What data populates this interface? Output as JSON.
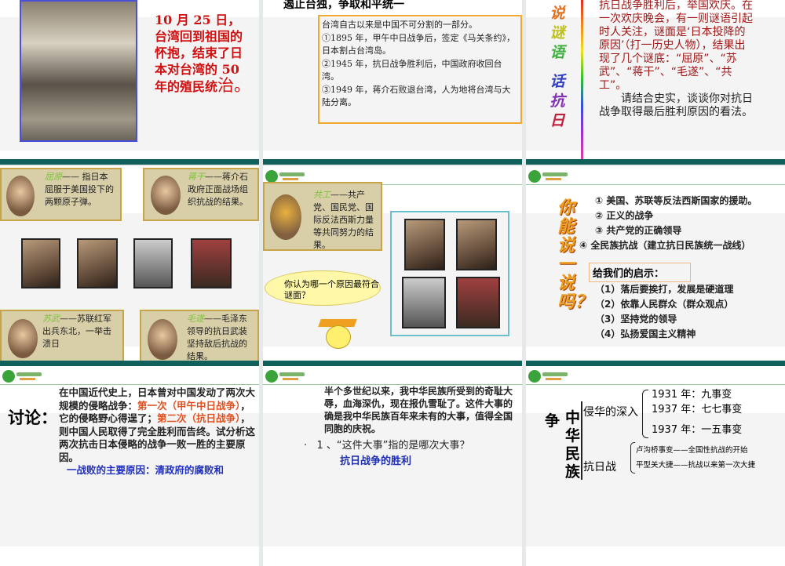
{
  "slides": [
    {
      "text_a": "10 月 25 日，",
      "text_b": "台湾回到祖国的怀抱，结束了日本对台湾的 50 年的殖民统",
      "text_c": "治。"
    },
    {
      "title": "遏止台独，争取和平统一",
      "lines": [
        "台湾自古以来是中国不可分割的一部分。",
        "①1895 年，甲午中日战争后，签定《马关条约》，日本割占台湾岛。",
        "②1945 年，抗日战争胜利后，中国政府收回台湾。",
        "③1949 年，蒋介石败退台湾，人为地将台湾与大陆分离。"
      ]
    },
    {
      "side_chars": [
        "说",
        "谜",
        "语",
        "话",
        "抗",
        "日"
      ],
      "riddle": "抗日战争胜利后，举国欢庆。在一次欢庆晚会，有一则谜语引起时人关注，谜面是‘日本投降的原因’（打一历史人物），结果出现了几个谜底：“屈原”、“苏武”、“蒋干”、“毛遂”、“共工”。",
      "prompt": "请结合史实，谈谈你对抗日战争取得最后胜利原因的看法。"
    },
    {
      "bubbles": [
        {
          "name": "屈原",
          "text": "—— 指日本屈服于美国投下的两颗原子弹。"
        },
        {
          "name": "蒋干",
          "text": "——蒋介石政府正面战场组织抗战的结果。"
        },
        {
          "name": "苏武",
          "text": "——苏联红军出兵东北，一举击溃日"
        },
        {
          "name": "毛遂",
          "text": "——毛泽东领导的抗日武装坚持敌后抗战的结果。"
        }
      ]
    },
    {
      "bubble_name": "共工",
      "bubble_text": "——共产党、国民党、国际反法西斯力量等共同努力的结果。",
      "question": "你认为哪一个原因最符合谜面？"
    },
    {
      "side_text": "你能说一说吗？",
      "answers": [
        "① 美国、苏联等反法西斯国家的援助。",
        "② 正义的战争",
        "③ 共产党的正确领导",
        "④ 全民族抗战（建立抗日民族统一战线）"
      ],
      "lesson_title": "给我们的启示：",
      "lessons": [
        "（1）落后要挨打，发展是硬道理",
        "（2）依靠人民群众（群众观点）",
        "（3）坚持党的领导",
        "（4）弘扬爱国主义精神"
      ]
    },
    {
      "label": "讨论：",
      "p1": "在中国近代史上，日本曾对中国发动了两次大规模的侵略战争：",
      "r1": "第一次（甲午中日战争）",
      "p2": "，它的侵略野心得逞了；",
      "r2": "第二次（抗日战争）",
      "p3": "，则中国人民取得了完全胜利而告终。试分析这两次抗击日本侵略的战争一败一胜的主要原因。",
      "blue": "一战败的主要原因：清政府的腐败和"
    },
    {
      "quote": "半个多世纪以来，我中华民族所受到的奇耻大辱，血海深仇，现在报仇雪耻了。这件大事的确是我中华民族百年来未有的大事，值得全国同胞的庆祝。",
      "q1": "1 、“这件大事”指的是哪次大事？",
      "a1": "抗日战争的胜利"
    },
    {
      "left": "争",
      "vertical": "中华民族",
      "branch1": "侵华的深入",
      "events": [
        "1931 年：九事变",
        "1937 年：七七事变",
        "1937 年：一五事变"
      ],
      "branch2": "抗日战",
      "battles": [
        "卢沟桥事变——全国性抗战的开始",
        "平型关大捷——抗战以来第一次大捷"
      ]
    }
  ]
}
